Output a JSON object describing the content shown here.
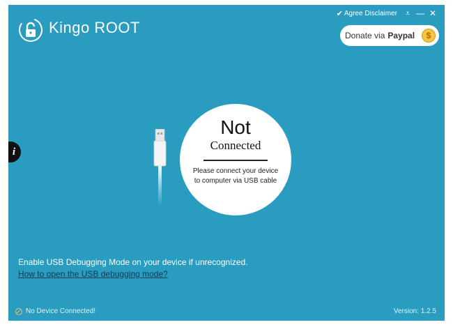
{
  "app": {
    "brand_prefix": "Kingo",
    "brand_suffix": "ROOT"
  },
  "topbar": {
    "check_icon": "✔",
    "agree_label": "Agree Disclaimer",
    "menu_icon": "⩡",
    "minimize_icon": "—",
    "close_icon": "✕"
  },
  "donate": {
    "label": "Donate via",
    "brand": "Paypal",
    "coin_glyph": "$"
  },
  "info": {
    "glyph": "i"
  },
  "status_card": {
    "title": "Not",
    "subtitle": "Connected",
    "message_line1": "Please connect your device",
    "message_line2": "to computer via USB cable"
  },
  "hint": {
    "text": "Enable USB Debugging Mode on your device if unrecognized.",
    "link": "How to open the USB debugging mode?"
  },
  "footer": {
    "status": "No Device Connected!",
    "version": "Version:  1.2.5"
  },
  "colors": {
    "background": "#2a9cc0",
    "card": "#ffffff",
    "link": "#123a4d",
    "coin": "#f5c542"
  }
}
